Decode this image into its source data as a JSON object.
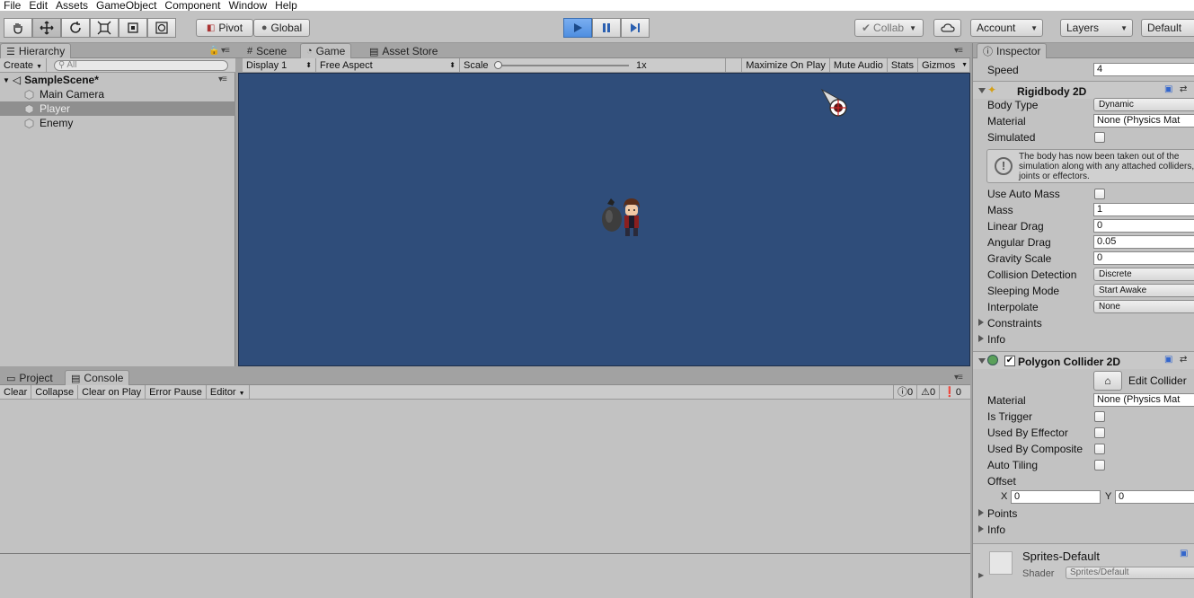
{
  "menu": [
    "File",
    "Edit",
    "Assets",
    "GameObject",
    "Component",
    "Window",
    "Help"
  ],
  "toolbar": {
    "pivot": "Pivot",
    "global": "Global",
    "collab": "Collab",
    "account": "Account",
    "layers": "Layers",
    "layout": "Default"
  },
  "hierarchy": {
    "tab": "Hierarchy",
    "create": "Create",
    "search_placeholder": "All",
    "scene": "SampleScene*",
    "items": [
      "Main Camera",
      "Player",
      "Enemy"
    ]
  },
  "game": {
    "tabs": [
      "Scene",
      "Game",
      "Asset Store"
    ],
    "display": "Display 1",
    "aspect": "Free Aspect",
    "scale_label": "Scale",
    "scale_value": "1x",
    "maximize": "Maximize On Play",
    "mute": "Mute Audio",
    "stats": "Stats",
    "gizmos": "Gizmos"
  },
  "console": {
    "tabs": [
      "Project",
      "Console"
    ],
    "buttons": [
      "Clear",
      "Collapse",
      "Clear on Play",
      "Error Pause",
      "Editor"
    ],
    "counts": [
      "0",
      "0",
      "0"
    ]
  },
  "inspector": {
    "tab": "Inspector",
    "speed_label": "Speed",
    "speed_value": "4",
    "rigidbody": {
      "title": "Rigidbody 2D",
      "body_type_label": "Body Type",
      "body_type": "Dynamic",
      "material_label": "Material",
      "material": "None (Physics Mat",
      "simulated_label": "Simulated",
      "warning": "The body has now been taken out of the simulation along with any attached colliders, joints or effectors.",
      "use_auto_mass_label": "Use Auto Mass",
      "mass_label": "Mass",
      "mass": "1",
      "linear_drag_label": "Linear Drag",
      "linear_drag": "0",
      "angular_drag_label": "Angular Drag",
      "angular_drag": "0.05",
      "gravity_label": "Gravity Scale",
      "gravity": "0",
      "collision_label": "Collision Detection",
      "collision": "Discrete",
      "sleeping_label": "Sleeping Mode",
      "sleeping": "Start Awake",
      "interpolate_label": "Interpolate",
      "interpolate": "None",
      "constraints": "Constraints",
      "info": "Info"
    },
    "collider": {
      "title": "Polygon Collider 2D",
      "edit": "Edit Collider",
      "material_label": "Material",
      "material": "None (Physics Mat",
      "is_trigger": "Is Trigger",
      "used_by_effector": "Used By Effector",
      "used_by_composite": "Used By Composite",
      "auto_tiling": "Auto Tiling",
      "offset": "Offset",
      "offset_x_label": "X",
      "offset_x": "0",
      "offset_y_label": "Y",
      "offset_y": "0",
      "points": "Points",
      "info": "Info"
    },
    "material": {
      "name": "Sprites-Default",
      "shader_label": "Shader",
      "shader": "Sprites/Default"
    }
  }
}
